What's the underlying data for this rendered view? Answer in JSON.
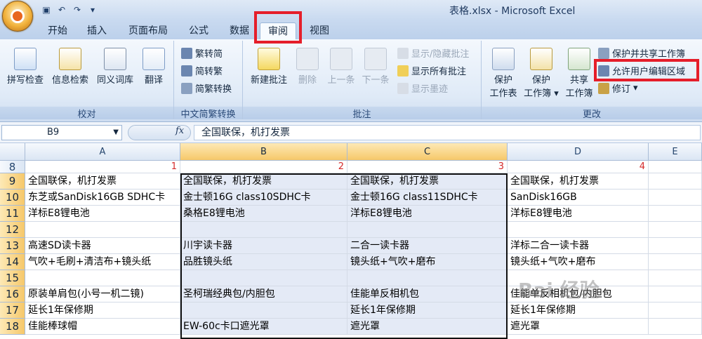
{
  "window": {
    "title": "表格.xlsx - Microsoft Excel"
  },
  "tabs": [
    "开始",
    "插入",
    "页面布局",
    "公式",
    "数据",
    "审阅",
    "视图"
  ],
  "active_tab": "审阅",
  "ribbon": {
    "proofing": {
      "label": "校对",
      "buttons": [
        "拼写检查",
        "信息检索",
        "同义词库",
        "翻译"
      ]
    },
    "chinese_conversion": {
      "label": "中文简繁转换",
      "buttons": [
        "繁转简",
        "简转繁",
        "简繁转换"
      ]
    },
    "comments": {
      "label": "批注",
      "new": "新建批注",
      "delete": "删除",
      "prev": "上一条",
      "next": "下一条",
      "show_hide": "显示/隐藏批注",
      "show_all": "显示所有批注",
      "show_ink": "显示墨迹"
    },
    "changes": {
      "label": "更改",
      "protect_sheet_1": "保护",
      "protect_sheet_2": "工作表",
      "protect_wb_1": "保护",
      "protect_wb_2": "工作簿",
      "share_wb_1": "共享",
      "share_wb_2": "工作簿",
      "protect_share": "保护并共享工作簿",
      "allow_edit": "允许用户编辑区域",
      "track": "修订"
    }
  },
  "formula_bar": {
    "name_box": "B9",
    "fx": "fx",
    "value": "全国联保，机打发票"
  },
  "columns": [
    "A",
    "B",
    "C",
    "D",
    "E"
  ],
  "rows": [
    {
      "n": "8",
      "a": "1",
      "b": "2",
      "c": "3",
      "d": "4"
    },
    {
      "n": "9",
      "a": "全国联保，机打发票",
      "b": "全国联保，机打发票",
      "c": "全国联保，机打发票",
      "d": "全国联保，机打发票"
    },
    {
      "n": "10",
      "a": "东芝或SanDisk16GB SDHC卡",
      "b": "金士顿16G class10SDHC卡",
      "c": "金士顿16G class11SDHC卡",
      "d": "SanDisk16GB"
    },
    {
      "n": "11",
      "a": "洋标E8锂电池",
      "b": "桑格E8锂电池",
      "c": "洋标E8锂电池",
      "d": "洋标E8锂电池"
    },
    {
      "n": "12",
      "a": "",
      "b": "",
      "c": "",
      "d": ""
    },
    {
      "n": "13",
      "a": "高速SD读卡器",
      "b": "川宇读卡器",
      "c": "二合一读卡器",
      "d": "洋标二合一读卡器"
    },
    {
      "n": "14",
      "a": "气吹+毛刷+清洁布+镜头纸",
      "b": "品胜镜头纸",
      "c": "镜头纸+气吹+磨布",
      "d": "镜头纸+气吹+磨布"
    },
    {
      "n": "15",
      "a": "",
      "b": "",
      "c": "",
      "d": ""
    },
    {
      "n": "16",
      "a": "原装单肩包(小号一机二镜)",
      "b": "圣柯瑞经典包/内胆包",
      "c": "佳能单反相机包",
      "d": "佳能单反相机包/内胆包"
    },
    {
      "n": "17",
      "a": "延长1年保修期",
      "b": "",
      "c": "延长1年保修期",
      "d": "延长1年保修期"
    },
    {
      "n": "18",
      "a": "佳能棒球帽",
      "b": "EW-60c卡口遮光罩",
      "c": "遮光罩",
      "d": "遮光罩"
    }
  ],
  "watermark": "Bai 经验"
}
